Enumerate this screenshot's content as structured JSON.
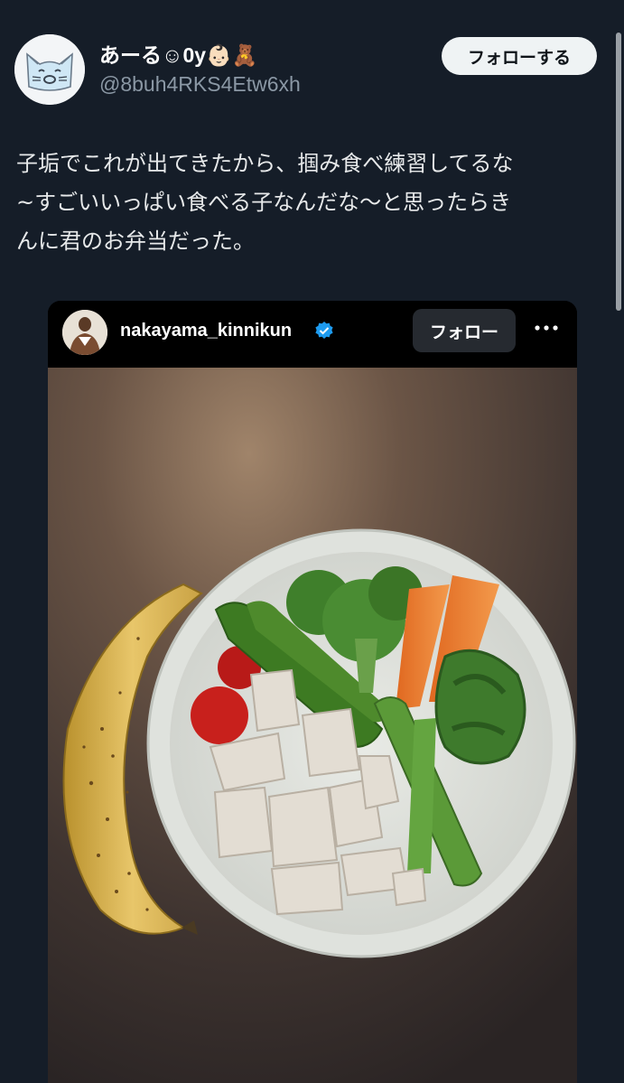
{
  "tweet": {
    "author": {
      "display_name": "あーる☺0y👶🏻🧸",
      "handle": "@8buh4RKS4Etw6xh",
      "avatar_icon": "cat-face-icon"
    },
    "follow_label": "フォローする",
    "text_lines": [
      "子垢でこれが出てきたから、掴み食べ練習してるな",
      "~すごいいっぱい食べる子なんだな〜と思ったらき",
      "んに君のお弁当だった。"
    ]
  },
  "embed": {
    "username": "nakayama_kinnikun",
    "verified_icon": "verified-badge-icon",
    "follow_label": "フォロー",
    "more_icon": "more-options-icon",
    "photo_subject": "food-photo"
  },
  "colors": {
    "background": "#151d28",
    "accent_blue": "#1d9bf0",
    "follow_button_bg": "#eff3f4"
  }
}
